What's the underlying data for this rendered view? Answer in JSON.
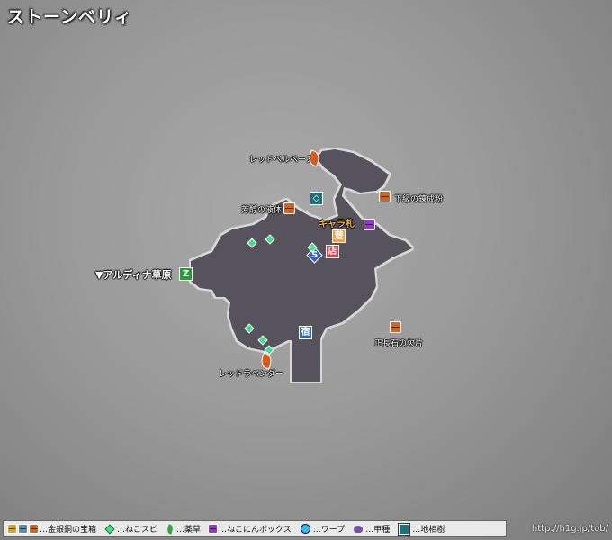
{
  "map": {
    "title": "ストーンベリィ",
    "labels": {
      "red_bellpepper": "レッドベルペーヌ",
      "lower_refine": "下級の錬成粉",
      "aromatic_liquid": "芳醇の液体",
      "chara_card": "キャラ札",
      "aldina": "▼アルディナ草原",
      "orthoclase": "正長石の欠片",
      "red_lavender": "レッドラベンダー"
    },
    "icons": {
      "guild_icon_text": "遊",
      "shop_icon_text": "店",
      "inn_icon_text": "宿",
      "save_icon_text": "S",
      "exit_icon_text": "Z"
    },
    "colors": {
      "terrain": "#57535c",
      "chest_bronze": "#c46a2d",
      "chest_purple": "#8e3fb8",
      "herb": "#d85a1a",
      "cat_gem": "#49d98a",
      "shop": "#d9434b",
      "guild": "#e6a64a",
      "inn": "#2f67b8",
      "exit": "#2b9a3a"
    }
  },
  "legend": {
    "chests": "…金銀銅の宝箱",
    "cat_gem": "…ねこスピ",
    "herb": "…薬草",
    "cat_box": "…ねこにんボックス",
    "warp": "…ワープ",
    "beetle": "…甲種",
    "tree": "…地相樹"
  },
  "footer": {
    "url": "http://h1g.jp/tob/"
  }
}
